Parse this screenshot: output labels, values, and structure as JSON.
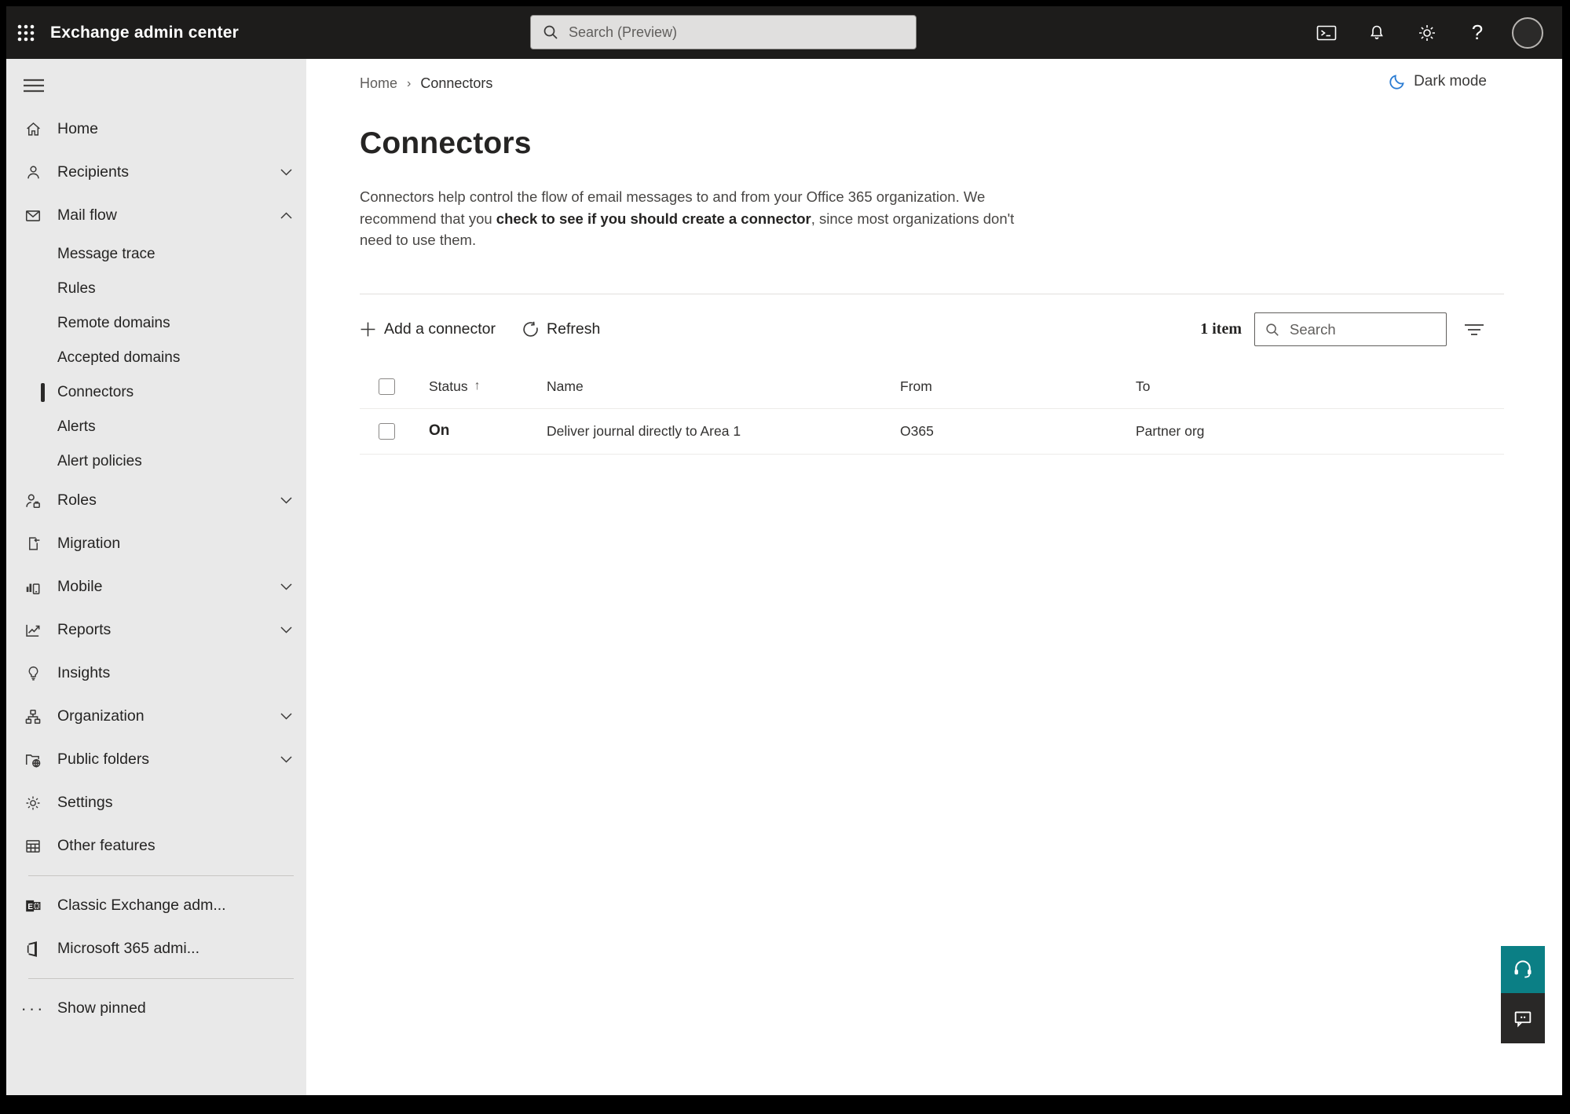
{
  "topbar": {
    "title": "Exchange admin center",
    "search_placeholder": "Search (Preview)"
  },
  "breadcrumb": {
    "home": "Home",
    "separator": "›",
    "current": "Connectors"
  },
  "dark_mode_label": "Dark mode",
  "page": {
    "title": "Connectors",
    "description_1": "Connectors help control the flow of email messages to and from your Office 365 organization. We recommend that you ",
    "description_link": "check to see if you should create a connector",
    "description_2": ", since most organizations don't need to use them."
  },
  "toolbar": {
    "add_label": "Add a connector",
    "refresh_label": "Refresh",
    "item_count": "1 item",
    "search_placeholder": "Search"
  },
  "table": {
    "headers": {
      "status": "Status",
      "name": "Name",
      "from": "From",
      "to": "To"
    },
    "sort_arrow": "↑",
    "rows": [
      {
        "status": "On",
        "name": "Deliver journal directly to Area 1",
        "from": "O365",
        "to": "Partner org"
      }
    ]
  },
  "sidebar": {
    "selected_item": "Connectors",
    "items": [
      {
        "label": "Home",
        "icon": "home-icon"
      },
      {
        "label": "Recipients",
        "icon": "person-icon",
        "chevron": "down"
      },
      {
        "label": "Mail flow",
        "icon": "mail-icon",
        "chevron": "up",
        "children": [
          "Message trace",
          "Rules",
          "Remote domains",
          "Accepted domains",
          "Connectors",
          "Alerts",
          "Alert policies"
        ]
      },
      {
        "label": "Roles",
        "icon": "roles-icon",
        "chevron": "down"
      },
      {
        "label": "Migration",
        "icon": "migration-icon"
      },
      {
        "label": "Mobile",
        "icon": "mobile-icon",
        "chevron": "down"
      },
      {
        "label": "Reports",
        "icon": "reports-icon",
        "chevron": "down"
      },
      {
        "label": "Insights",
        "icon": "lightbulb-icon"
      },
      {
        "label": "Organization",
        "icon": "org-chart-icon",
        "chevron": "down"
      },
      {
        "label": "Public folders",
        "icon": "public-folder-icon",
        "chevron": "down"
      },
      {
        "label": "Settings",
        "icon": "gear-icon"
      },
      {
        "label": "Other features",
        "icon": "table-grid-icon"
      }
    ],
    "footer": [
      {
        "label": "Classic Exchange adm...",
        "icon": "exchange-logo-icon"
      },
      {
        "label": "Microsoft 365 admi...",
        "icon": "office-logo-icon"
      },
      {
        "label": "Show pinned",
        "icon": "ellipsis-icon"
      }
    ]
  },
  "colors": {
    "topbar_bg": "#1d1c1b",
    "sidebar_bg": "#e9e9e9",
    "support_teal": "#0b7f85",
    "feedback_dark": "#292827",
    "moon_blue": "#2b7cd3"
  }
}
